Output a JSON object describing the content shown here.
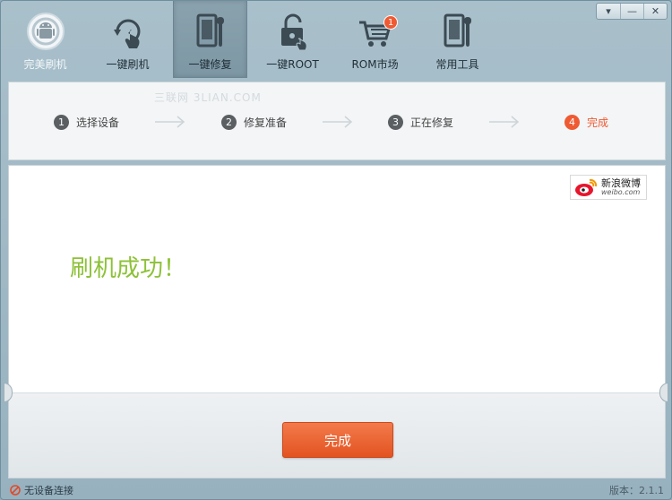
{
  "window": {
    "controls": [
      {
        "name": "menu",
        "glyph": "▾"
      },
      {
        "name": "minimize",
        "glyph": "—"
      },
      {
        "name": "close",
        "glyph": "✕"
      }
    ]
  },
  "toolbar": {
    "items": [
      {
        "label": "完美刷机",
        "icon": "android-icon"
      },
      {
        "label": "一键刷机",
        "icon": "refresh-hand-icon"
      },
      {
        "label": "一键修复",
        "icon": "phone-wrench-icon"
      },
      {
        "label": "一键ROOT",
        "icon": "unlock-icon"
      },
      {
        "label": "ROM市场",
        "icon": "cart-icon",
        "badge": "1"
      },
      {
        "label": "常用工具",
        "icon": "tools-icon"
      }
    ],
    "active_index": 2
  },
  "steps": {
    "watermark": "三联网 3LIAN.COM",
    "items": [
      {
        "num": "1",
        "label": "选择设备"
      },
      {
        "num": "2",
        "label": "修复准备"
      },
      {
        "num": "3",
        "label": "正在修复"
      },
      {
        "num": "4",
        "label": "完成"
      }
    ],
    "current": 4
  },
  "content": {
    "weibo_cn": "新浪微博",
    "weibo_en": "weibo.com",
    "success_text": "刷机成功！",
    "done_button": "完成"
  },
  "status": {
    "device_text": "无设备连接",
    "version": "版本：2.1.1"
  },
  "colors": {
    "accent": "#ef5a32",
    "success": "#8dc137",
    "frame": "#a9c0cb"
  }
}
